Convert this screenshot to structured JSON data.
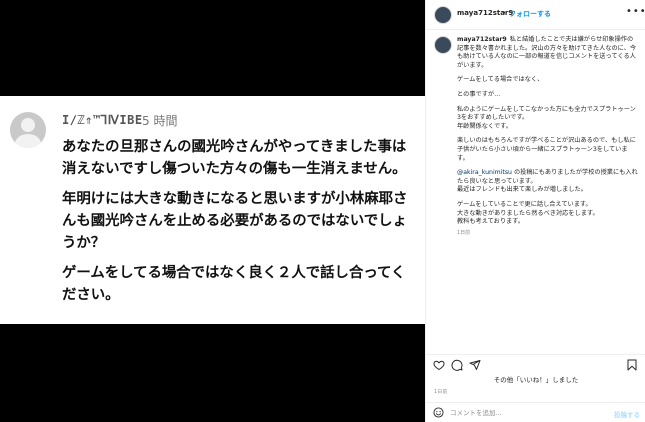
{
  "media": {
    "comment": {
      "username": "I∕ℤ⇑™⅂ⅣΙΒΕ",
      "time": "5 時間",
      "paragraphs": [
        "あなたの旦那さんの國光吟さんがやってきました事は消えないですし傷ついた方々の傷も一生消えません。",
        "年明けには大きな動きになると思いますが小林麻耶さんも國光吟さんを止める必要があるのではないでしょうか？",
        "ゲームをしてる場合ではなく良く２人で話し合ってください。"
      ]
    }
  },
  "header": {
    "username": "maya712star9",
    "separator": "•",
    "follow_label": "フォローする",
    "more_label": "•••"
  },
  "caption": {
    "username": "maya712star9",
    "intro": "私と結婚したことで夫は嫌がらせ印象操作の記事を数々書かれました。沢山の方々を助けてきた人なのに、今も助けている人なのに一部の報道を信じコメントを送ってくる人がいます。",
    "line2": "ゲームをしてる場合ではなく、",
    "line3": "との事ですが…",
    "line4": "私のようにゲームをしてこなかった方にも全力でスプラトゥーン3をおすすめしたいです。",
    "line5": "年齢関係なくです。",
    "line6": "楽しいのはもちろんですが学べることが沢山あるので、もし私に子供がいたら小さい頃から一緒にスプラトゥーン3をしています。",
    "mention": "@akira_kunimitsu",
    "line7_rest": " の投稿にもありましたが学校の授業にも入れたら良いなと思っています。",
    "line8": "最近はフレンドも出来て楽しみが増しました。",
    "line9": "ゲームをしていることで更に話し合えています。",
    "line10": "大きな動きがありましたら然るべき対応をします。",
    "line11": "教科も考えております。",
    "age": "1日前"
  },
  "footer": {
    "likes_text": "その他「いいね！」しました",
    "date": "1日前",
    "comment_placeholder": "コメントを追加...",
    "post_label": "投稿する"
  },
  "colors": {
    "accent": "#0095f6",
    "mention": "#00376b",
    "post_disabled": "#b2dffc",
    "media_bg": "#000000"
  },
  "icons": {
    "like": "heart-icon",
    "comment": "comment-icon",
    "share": "paper-plane-icon",
    "save": "bookmark-icon",
    "emoji": "emoji-icon",
    "more": "more-icon"
  }
}
